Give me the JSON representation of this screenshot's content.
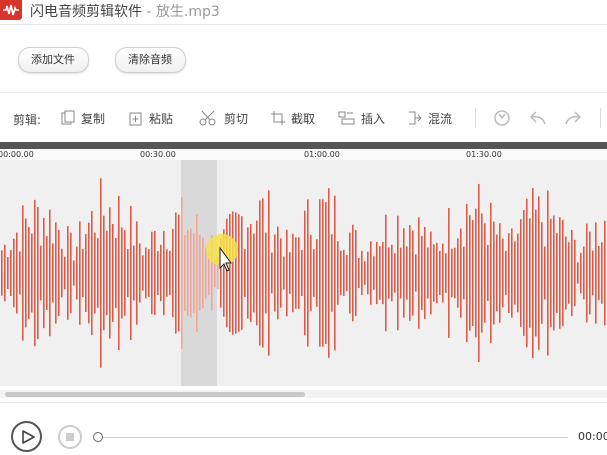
{
  "window": {
    "app_name": "闪电音频剪辑软件",
    "separator": " - ",
    "file_name": "放生.mp3"
  },
  "file_buttons": {
    "add_file": "添加文件",
    "clear_audio": "清除音频"
  },
  "toolbar": {
    "label": "剪辑:",
    "copy": "复制",
    "paste": "粘贴",
    "cut": "剪切",
    "crop": "截取",
    "insert": "插入",
    "mix": "混流"
  },
  "timeline": {
    "ticks": [
      "00:00.00",
      "00:30.00",
      "01:00.00",
      "01:30.00"
    ]
  },
  "waveform": {
    "color": "#e05a48",
    "selected_color": "#f0a79a",
    "selection_bg": "#d9d9d9"
  },
  "player": {
    "time": "00:00"
  }
}
